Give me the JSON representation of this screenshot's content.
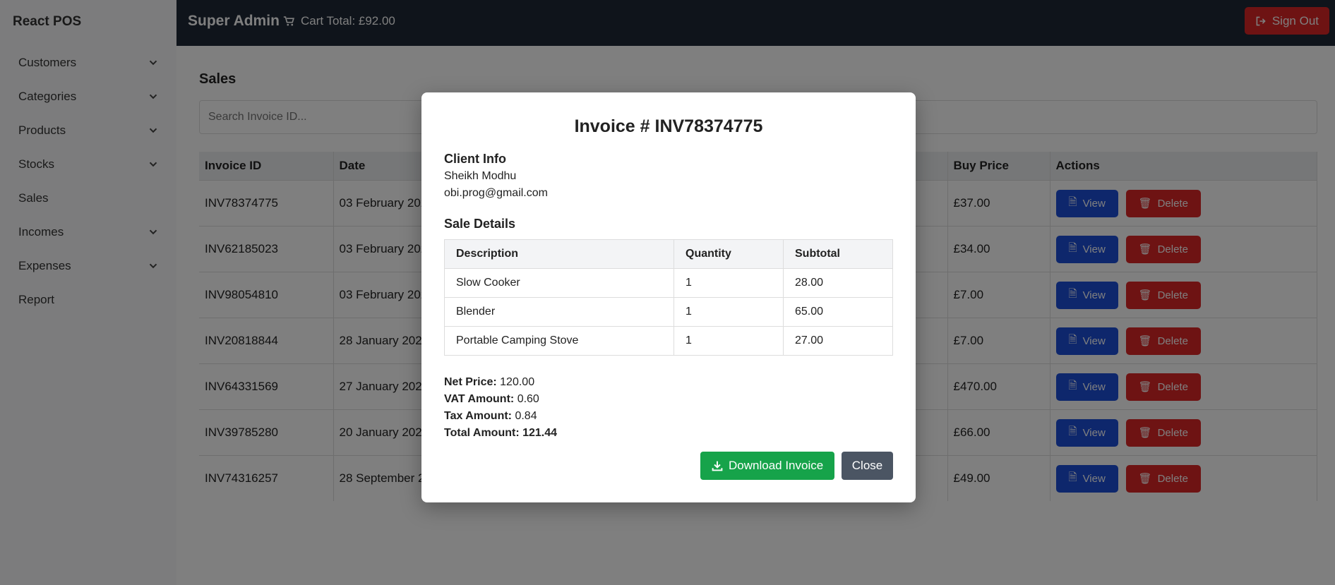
{
  "sidebar": {
    "brand": "React POS",
    "items": [
      {
        "label": "Customers",
        "chevron": true
      },
      {
        "label": "Categories",
        "chevron": true
      },
      {
        "label": "Products",
        "chevron": true
      },
      {
        "label": "Stocks",
        "chevron": true
      },
      {
        "label": "Sales",
        "chevron": false
      },
      {
        "label": "Incomes",
        "chevron": true
      },
      {
        "label": "Expenses",
        "chevron": true
      },
      {
        "label": "Report",
        "chevron": false
      }
    ]
  },
  "header": {
    "title": "Super Admin",
    "cart_total": "Cart Total: £92.00",
    "sign_out": "Sign Out"
  },
  "main": {
    "title": "Sales",
    "search_placeholder": "Search Invoice ID...",
    "columns": [
      "Invoice ID",
      "Date",
      "Buy Price",
      "Actions"
    ],
    "rows": [
      {
        "invoice_id": "INV78374775",
        "date": "03 February 2025",
        "buy_price": "£37.00"
      },
      {
        "invoice_id": "INV62185023",
        "date": "03 February 2025",
        "buy_price": "£34.00"
      },
      {
        "invoice_id": "INV98054810",
        "date": "03 February 2025",
        "buy_price": "£7.00"
      },
      {
        "invoice_id": "INV20818844",
        "date": "28 January 2025",
        "buy_price": "£7.00"
      },
      {
        "invoice_id": "INV64331569",
        "date": "27 January 2025",
        "buy_price": "£470.00"
      },
      {
        "invoice_id": "INV39785280",
        "date": "20 January 2025",
        "buy_price": "£66.00"
      },
      {
        "invoice_id": "INV74316257",
        "date": "28 September 2024",
        "buy_price": "£49.00"
      }
    ],
    "view_label": "View",
    "delete_label": "Delete"
  },
  "modal": {
    "title": "Invoice # INV78374775",
    "client_info_title": "Client Info",
    "client_name": "Sheikh Modhu",
    "client_email": "obi.prog@gmail.com",
    "sale_details_title": "Sale Details",
    "columns": [
      "Description",
      "Quantity",
      "Subtotal"
    ],
    "items": [
      {
        "description": "Slow Cooker",
        "quantity": "1",
        "subtotal": "28.00"
      },
      {
        "description": "Blender",
        "quantity": "1",
        "subtotal": "65.00"
      },
      {
        "description": "Portable Camping Stove",
        "quantity": "1",
        "subtotal": "27.00"
      }
    ],
    "net_price_label": "Net Price:",
    "net_price": "120.00",
    "vat_label": "VAT Amount:",
    "vat": "0.60",
    "tax_label": "Tax Amount:",
    "tax": "0.84",
    "total_label": "Total Amount:",
    "total": "121.44",
    "download_label": "Download Invoice",
    "close_label": "Close"
  },
  "colors": {
    "topbar": "#1f2937",
    "primary": "#1d4ed8",
    "danger": "#dc2626",
    "success": "#16a34a",
    "secondary": "#4b5563"
  },
  "icons": {
    "cart": "cart-icon",
    "sign_out": "sign-out-icon",
    "view": "document-icon",
    "delete": "trash-icon",
    "download": "download-icon",
    "chevron": "chevron-down-icon"
  }
}
